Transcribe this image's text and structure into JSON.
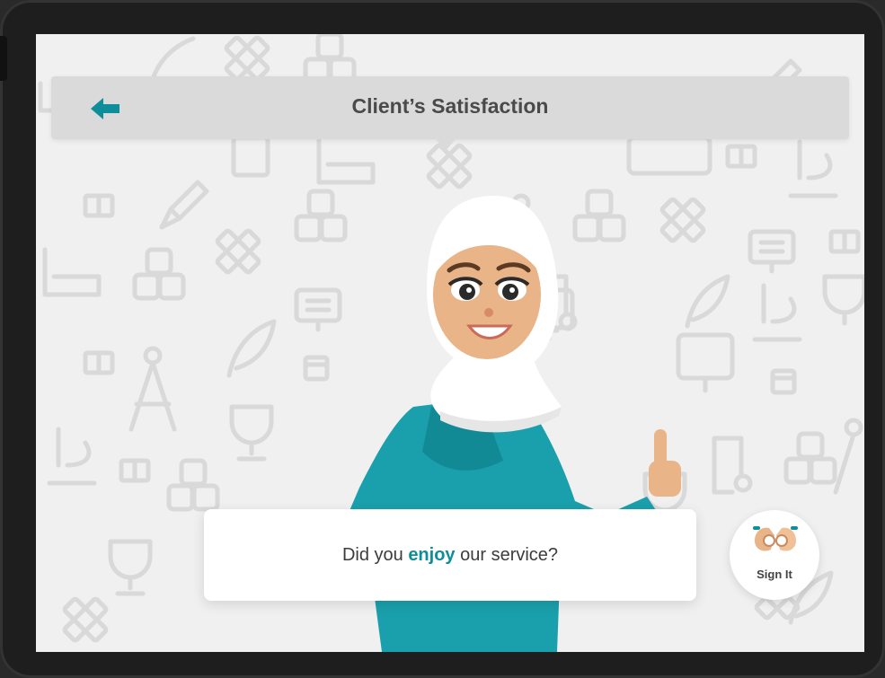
{
  "header": {
    "title": "Client’s Satisfaction",
    "back_icon": "arrow-left-icon"
  },
  "question": {
    "prefix": "Did you ",
    "highlight": "enjoy",
    "suffix": " our service?"
  },
  "sign_button": {
    "label": "Sign It",
    "icon": "sign-language-hands-icon"
  },
  "colors": {
    "accent": "#0e8e9a",
    "header_bg": "#dadada",
    "screen_bg": "#f0f0f0",
    "dress": "#1aa0ac",
    "skin": "#e9b487"
  }
}
